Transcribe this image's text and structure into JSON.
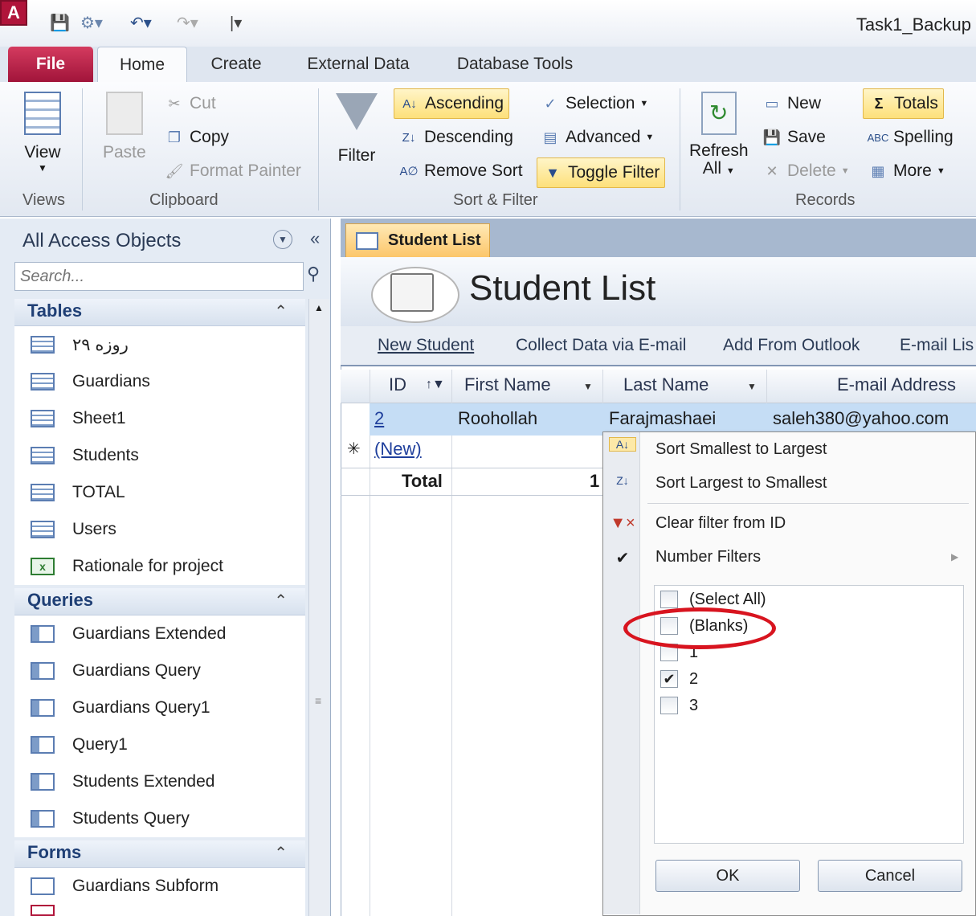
{
  "window": {
    "title": "Task1_Backup",
    "app_logo": "A"
  },
  "tabs": {
    "file": "File",
    "home": "Home",
    "create": "Create",
    "external": "External Data",
    "dbtools": "Database Tools"
  },
  "ribbon": {
    "views": {
      "view": "View",
      "label": "Views"
    },
    "clipboard": {
      "paste": "Paste",
      "cut": "Cut",
      "copy": "Copy",
      "format_painter": "Format Painter",
      "label": "Clipboard"
    },
    "sort_filter": {
      "filter": "Filter",
      "ascending": "Ascending",
      "descending": "Descending",
      "remove_sort": "Remove Sort",
      "selection": "Selection",
      "advanced": "Advanced",
      "toggle_filter": "Toggle Filter",
      "label": "Sort & Filter"
    },
    "records": {
      "refresh": "Refresh",
      "refresh_all": "All",
      "new": "New",
      "save": "Save",
      "delete": "Delete",
      "totals": "Totals",
      "spelling": "Spelling",
      "more": "More",
      "label": "Records"
    }
  },
  "nav": {
    "title": "All Access Objects",
    "search_placeholder": "Search...",
    "tables_header": "Tables",
    "tables": [
      "۲۹ روزه",
      "Guardians",
      "Sheet1",
      "Students",
      "TOTAL",
      "Users",
      "Rationale for project"
    ],
    "queries_header": "Queries",
    "queries": [
      "Guardians Extended",
      "Guardians Query",
      "Guardians Query1",
      "Query1",
      "Students Extended",
      "Students Query"
    ],
    "forms_header": "Forms",
    "forms": [
      "Guardians Subform"
    ]
  },
  "document": {
    "tab": "Student List",
    "title": "Student List",
    "commands": [
      "New Student",
      "Collect Data via E-mail",
      "Add From Outlook",
      "E-mail Lis"
    ],
    "columns": [
      "ID",
      "First Name",
      "Last Name",
      "E-mail Address"
    ],
    "row": {
      "id": "2",
      "first": "Roohollah",
      "last": "Farajmashaei",
      "email": "saleh380@yahoo.com"
    },
    "new_row": "(New)",
    "new_marker": "✳",
    "total_label": "Total",
    "total_value": "1"
  },
  "filter_menu": {
    "sort_asc": "Sort Smallest to Largest",
    "sort_desc": "Sort Largest to Smallest",
    "clear": "Clear filter from ID",
    "number_filters": "Number Filters",
    "items": [
      {
        "label": "(Select All)",
        "checked": false
      },
      {
        "label": "(Blanks)",
        "checked": false
      },
      {
        "label": "1",
        "checked": false
      },
      {
        "label": "2",
        "checked": true
      },
      {
        "label": "3",
        "checked": false
      }
    ],
    "ok": "OK",
    "cancel": "Cancel"
  },
  "colors": {
    "accent_file": "#b0143a",
    "highlight": "#fde07a",
    "annotation": "#d8141f"
  }
}
